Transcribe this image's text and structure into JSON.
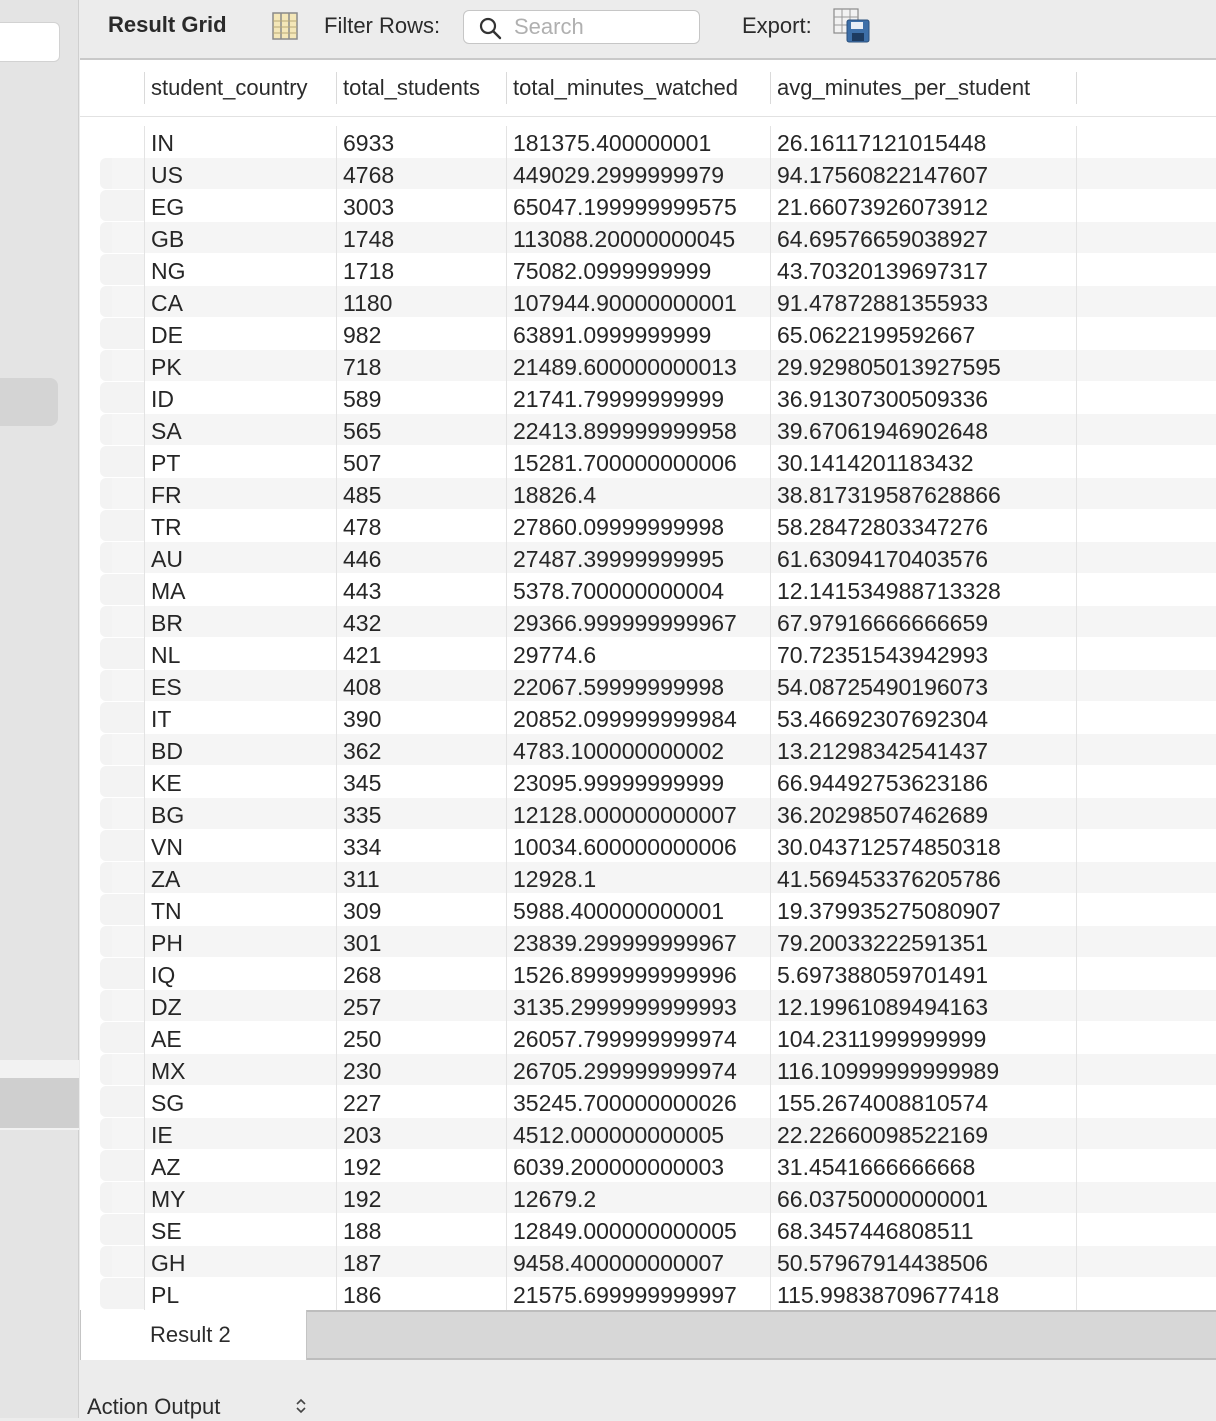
{
  "toolbar": {
    "title": "Result Grid",
    "filter_label": "Filter Rows:",
    "search_placeholder": "Search",
    "export_label": "Export:"
  },
  "grid": {
    "columns": [
      "student_country",
      "total_students",
      "total_minutes_watched",
      "avg_minutes_per_student"
    ],
    "rows": [
      [
        "IN",
        "6933",
        "181375.400000001",
        "26.16117121015448"
      ],
      [
        "US",
        "4768",
        "449029.2999999979",
        "94.17560822147607"
      ],
      [
        "EG",
        "3003",
        "65047.199999999575",
        "21.66073926073912"
      ],
      [
        "GB",
        "1748",
        "113088.20000000045",
        "64.69576659038927"
      ],
      [
        "NG",
        "1718",
        "75082.0999999999",
        "43.70320139697317"
      ],
      [
        "CA",
        "1180",
        "107944.90000000001",
        "91.47872881355933"
      ],
      [
        "DE",
        "982",
        "63891.0999999999",
        "65.0622199592667"
      ],
      [
        "PK",
        "718",
        "21489.600000000013",
        "29.929805013927595"
      ],
      [
        "ID",
        "589",
        "21741.79999999999",
        "36.91307300509336"
      ],
      [
        "SA",
        "565",
        "22413.899999999958",
        "39.67061946902648"
      ],
      [
        "PT",
        "507",
        "15281.700000000006",
        "30.1414201183432"
      ],
      [
        "FR",
        "485",
        "18826.4",
        "38.817319587628866"
      ],
      [
        "TR",
        "478",
        "27860.09999999998",
        "58.28472803347276"
      ],
      [
        "AU",
        "446",
        "27487.39999999995",
        "61.63094170403576"
      ],
      [
        "MA",
        "443",
        "5378.700000000004",
        "12.141534988713328"
      ],
      [
        "BR",
        "432",
        "29366.999999999967",
        "67.97916666666659"
      ],
      [
        "NL",
        "421",
        "29774.6",
        "70.72351543942993"
      ],
      [
        "ES",
        "408",
        "22067.59999999998",
        "54.08725490196073"
      ],
      [
        "IT",
        "390",
        "20852.099999999984",
        "53.46692307692304"
      ],
      [
        "BD",
        "362",
        "4783.100000000002",
        "13.21298342541437"
      ],
      [
        "KE",
        "345",
        "23095.99999999999",
        "66.94492753623186"
      ],
      [
        "BG",
        "335",
        "12128.000000000007",
        "36.20298507462689"
      ],
      [
        "VN",
        "334",
        "10034.600000000006",
        "30.043712574850318"
      ],
      [
        "ZA",
        "311",
        "12928.1",
        "41.569453376205786"
      ],
      [
        "TN",
        "309",
        "5988.400000000001",
        "19.379935275080907"
      ],
      [
        "PH",
        "301",
        "23839.299999999967",
        "79.20033222591351"
      ],
      [
        "IQ",
        "268",
        "1526.8999999999996",
        "5.697388059701491"
      ],
      [
        "DZ",
        "257",
        "3135.2999999999993",
        "12.19961089494163"
      ],
      [
        "AE",
        "250",
        "26057.799999999974",
        "104.2311999999999"
      ],
      [
        "MX",
        "230",
        "26705.299999999974",
        "116.10999999999989"
      ],
      [
        "SG",
        "227",
        "35245.700000000026",
        "155.2674008810574"
      ],
      [
        "IE",
        "203",
        "4512.000000000005",
        "22.22660098522169"
      ],
      [
        "AZ",
        "192",
        "6039.200000000003",
        "31.4541666666668"
      ],
      [
        "MY",
        "192",
        "12679.2",
        "66.03750000000001"
      ],
      [
        "SE",
        "188",
        "12849.000000000005",
        "68.3457446808511"
      ],
      [
        "GH",
        "187",
        "9458.400000000007",
        "50.57967914438506"
      ],
      [
        "PL",
        "186",
        "21575.699999999997",
        "115.99838709677418"
      ]
    ]
  },
  "result_tab": {
    "label": "Result 2"
  },
  "action_output": {
    "label": "Action Output"
  },
  "icons": {
    "grid": "column-grid-icon",
    "search": "search-icon",
    "export": "export-icon",
    "select": "up-down-chevron-icon"
  }
}
